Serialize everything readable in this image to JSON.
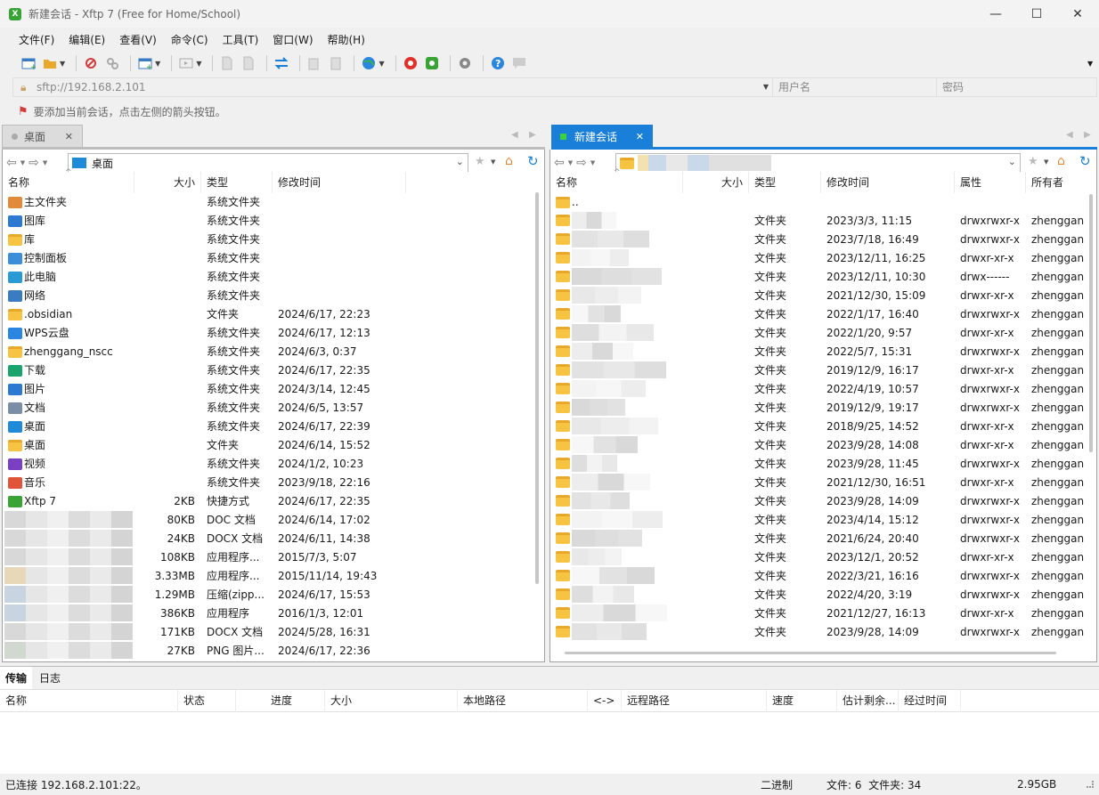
{
  "window": {
    "title": "新建会话 - Xftp 7 (Free for Home/School)",
    "app_icon": "X",
    "minimize": "—",
    "maximize": "☐",
    "close": "✕"
  },
  "menu": [
    "文件(F)",
    "编辑(E)",
    "查看(V)",
    "命令(C)",
    "工具(T)",
    "窗口(W)",
    "帮助(H)"
  ],
  "address": {
    "host": "sftp://192.168.2.101",
    "user_placeholder": "用户名",
    "pass_placeholder": "密码"
  },
  "hint": "要添加当前会话，点击左侧的箭头按钮。",
  "left": {
    "tab_label": "桌面",
    "path": "桌面",
    "columns": [
      "名称",
      "大小",
      "类型",
      "修改时间"
    ],
    "rows": [
      {
        "name": "主文件夹",
        "size": "",
        "type": "系统文件夹",
        "mtime": "",
        "icon": "home-icon",
        "color": "#e08a3a"
      },
      {
        "name": "图库",
        "size": "",
        "type": "系统文件夹",
        "mtime": "",
        "icon": "gallery-icon",
        "color": "#2b79d0"
      },
      {
        "name": "库",
        "size": "",
        "type": "系统文件夹",
        "mtime": "",
        "icon": "folder-icon",
        "color": "#f6c343"
      },
      {
        "name": "控制面板",
        "size": "",
        "type": "系统文件夹",
        "mtime": "",
        "icon": "control-panel-icon",
        "color": "#3a8fd8"
      },
      {
        "name": "此电脑",
        "size": "",
        "type": "系统文件夹",
        "mtime": "",
        "icon": "computer-icon",
        "color": "#2a9ad6"
      },
      {
        "name": "网络",
        "size": "",
        "type": "系统文件夹",
        "mtime": "",
        "icon": "network-icon",
        "color": "#3a7cc4"
      },
      {
        "name": ".obsidian",
        "size": "",
        "type": "文件夹",
        "mtime": "2024/6/17, 22:23",
        "icon": "folder-icon",
        "color": "#f6c343"
      },
      {
        "name": "WPS云盘",
        "size": "",
        "type": "系统文件夹",
        "mtime": "2024/6/17, 12:13",
        "icon": "cloud-icon",
        "color": "#2b86e0"
      },
      {
        "name": "zhenggang_nscc",
        "size": "",
        "type": "系统文件夹",
        "mtime": "2024/6/3, 0:37",
        "icon": "folder-icon",
        "color": "#f6c343"
      },
      {
        "name": "下载",
        "size": "",
        "type": "系统文件夹",
        "mtime": "2024/6/17, 22:35",
        "icon": "download-icon",
        "color": "#1aa36a"
      },
      {
        "name": "图片",
        "size": "",
        "type": "系统文件夹",
        "mtime": "2024/3/14, 12:45",
        "icon": "pictures-icon",
        "color": "#2b79d0"
      },
      {
        "name": "文档",
        "size": "",
        "type": "系统文件夹",
        "mtime": "2024/6/5, 13:57",
        "icon": "documents-icon",
        "color": "#7a8fa6"
      },
      {
        "name": "桌面",
        "size": "",
        "type": "系统文件夹",
        "mtime": "2024/6/17, 22:39",
        "icon": "desktop-icon",
        "color": "#1f8ad8"
      },
      {
        "name": "桌面",
        "size": "",
        "type": "文件夹",
        "mtime": "2024/6/14, 15:52",
        "icon": "folder-icon",
        "color": "#f6c343"
      },
      {
        "name": "视频",
        "size": "",
        "type": "系统文件夹",
        "mtime": "2024/1/2, 10:23",
        "icon": "video-icon",
        "color": "#7b3fc4"
      },
      {
        "name": "音乐",
        "size": "",
        "type": "系统文件夹",
        "mtime": "2023/9/18, 22:16",
        "icon": "music-icon",
        "color": "#e0553a"
      },
      {
        "name": "Xftp 7",
        "size": "2KB",
        "type": "快捷方式",
        "mtime": "2024/6/17, 22:35",
        "icon": "xftp-shortcut-icon",
        "color": "#3aa335"
      },
      {
        "name": "",
        "size": "80KB",
        "type": "DOC 文档",
        "mtime": "2024/6/14, 17:02",
        "icon": "blurred",
        "color": "#d8d8d8"
      },
      {
        "name": "",
        "size": "24KB",
        "type": "DOCX 文档",
        "mtime": "2024/6/11, 14:38",
        "icon": "blurred",
        "color": "#d8d8d8"
      },
      {
        "name": "",
        "size": "108KB",
        "type": "应用程序...",
        "mtime": "2015/7/3, 5:07",
        "icon": "blurred",
        "color": "#d8d8d8"
      },
      {
        "name": "",
        "size": "3.33MB",
        "type": "应用程序...",
        "mtime": "2015/11/14, 19:43",
        "icon": "blurred",
        "color": "#e6d8b8"
      },
      {
        "name": "",
        "size": "1.29MB",
        "type": "压缩(zipp...",
        "mtime": "2024/6/17, 15:53",
        "icon": "blurred",
        "color": "#c8d4e0"
      },
      {
        "name": "",
        "size": "386KB",
        "type": "应用程序",
        "mtime": "2016/1/3, 12:01",
        "icon": "blurred",
        "color": "#c8d4e0"
      },
      {
        "name": "",
        "size": "171KB",
        "type": "DOCX 文档",
        "mtime": "2024/5/28, 16:31",
        "icon": "blurred",
        "color": "#d8d8d8"
      },
      {
        "name": "",
        "size": "27KB",
        "type": "PNG 图片...",
        "mtime": "2024/6/17, 22:36",
        "icon": "blurred",
        "color": "#d0d8d0"
      }
    ]
  },
  "right": {
    "tab_label": "新建会话",
    "columns": [
      "名称",
      "大小",
      "类型",
      "修改时间",
      "属性",
      "所有者"
    ],
    "parent": "..",
    "rows": [
      {
        "type": "文件夹",
        "mtime": "2023/3/3, 11:15",
        "attr": "drwxrwxr-x",
        "owner": "zhenggan"
      },
      {
        "type": "文件夹",
        "mtime": "2023/7/18, 16:49",
        "attr": "drwxrwxr-x",
        "owner": "zhenggan"
      },
      {
        "type": "文件夹",
        "mtime": "2023/12/11, 16:25",
        "attr": "drwxr-xr-x",
        "owner": "zhenggan"
      },
      {
        "type": "文件夹",
        "mtime": "2023/12/11, 10:30",
        "attr": "drwx------",
        "owner": "zhenggan"
      },
      {
        "type": "文件夹",
        "mtime": "2021/12/30, 15:09",
        "attr": "drwxr-xr-x",
        "owner": "zhenggan"
      },
      {
        "type": "文件夹",
        "mtime": "2022/1/17, 16:40",
        "attr": "drwxrwxr-x",
        "owner": "zhenggan"
      },
      {
        "type": "文件夹",
        "mtime": "2022/1/20, 9:57",
        "attr": "drwxr-xr-x",
        "owner": "zhenggan"
      },
      {
        "type": "文件夹",
        "mtime": "2022/5/7, 15:31",
        "attr": "drwxrwxr-x",
        "owner": "zhenggan"
      },
      {
        "type": "文件夹",
        "mtime": "2019/12/9, 16:17",
        "attr": "drwxr-xr-x",
        "owner": "zhenggan"
      },
      {
        "type": "文件夹",
        "mtime": "2022/4/19, 10:57",
        "attr": "drwxrwxr-x",
        "owner": "zhenggan"
      },
      {
        "type": "文件夹",
        "mtime": "2019/12/9, 19:17",
        "attr": "drwxrwxr-x",
        "owner": "zhenggan"
      },
      {
        "type": "文件夹",
        "mtime": "2018/9/25, 14:52",
        "attr": "drwxr-xr-x",
        "owner": "zhenggan"
      },
      {
        "type": "文件夹",
        "mtime": "2023/9/28, 14:08",
        "attr": "drwxr-xr-x",
        "owner": "zhenggan"
      },
      {
        "type": "文件夹",
        "mtime": "2023/9/28, 11:45",
        "attr": "drwxrwxr-x",
        "owner": "zhenggan"
      },
      {
        "type": "文件夹",
        "mtime": "2021/12/30, 16:51",
        "attr": "drwxr-xr-x",
        "owner": "zhenggan"
      },
      {
        "type": "文件夹",
        "mtime": "2023/9/28, 14:09",
        "attr": "drwxrwxr-x",
        "owner": "zhenggan"
      },
      {
        "type": "文件夹",
        "mtime": "2023/4/14, 15:12",
        "attr": "drwxrwxr-x",
        "owner": "zhenggan"
      },
      {
        "type": "文件夹",
        "mtime": "2021/6/24, 20:40",
        "attr": "drwxrwxr-x",
        "owner": "zhenggan"
      },
      {
        "type": "文件夹",
        "mtime": "2023/12/1, 20:52",
        "attr": "drwxr-xr-x",
        "owner": "zhenggan"
      },
      {
        "type": "文件夹",
        "mtime": "2022/3/21, 16:16",
        "attr": "drwxrwxr-x",
        "owner": "zhenggan"
      },
      {
        "type": "文件夹",
        "mtime": "2022/4/20, 3:19",
        "attr": "drwxrwxr-x",
        "owner": "zhenggan"
      },
      {
        "type": "文件夹",
        "mtime": "2021/12/27, 16:13",
        "attr": "drwxr-xr-x",
        "owner": "zhenggan"
      },
      {
        "type": "文件夹",
        "mtime": "2023/9/28, 14:09",
        "attr": "drwxrwxr-x",
        "owner": "zhenggan"
      }
    ]
  },
  "transfer": {
    "tabs": [
      "传输",
      "日志"
    ],
    "columns": [
      "名称",
      "状态",
      "进度",
      "大小",
      "本地路径",
      "<->",
      "远程路径",
      "速度",
      "估计剩余...",
      "经过时间"
    ]
  },
  "status": {
    "connection": "已连接 192.168.2.101:22。",
    "mode": "二进制",
    "counts": "文件: 6  文件夹: 34",
    "size": "2.95GB"
  },
  "colors": {
    "accent": "#0a78d4",
    "active_tab": "#1a7fd8",
    "folder": "#f6c343",
    "session_dot": "#3ad13a"
  }
}
